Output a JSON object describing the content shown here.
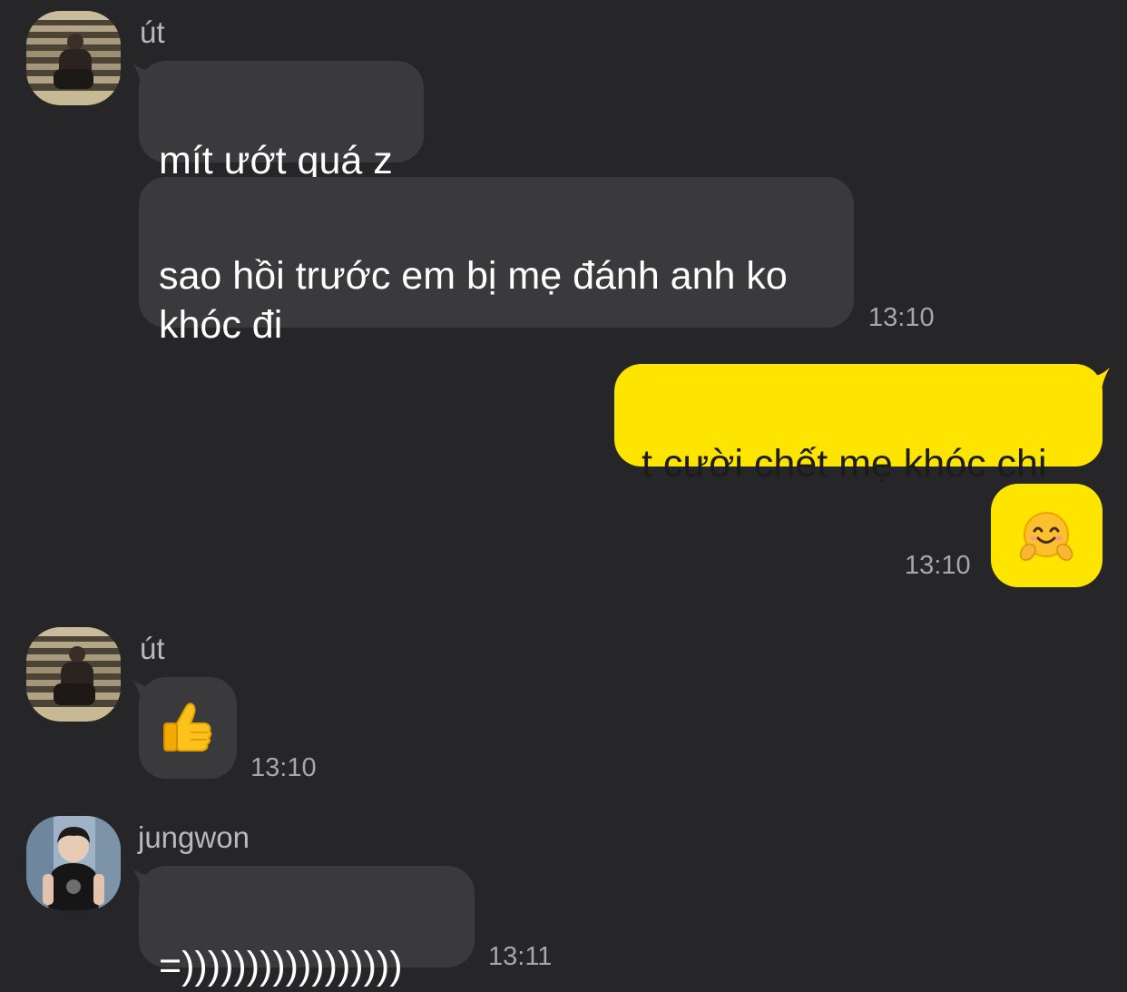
{
  "messages": [
    {
      "type": "received",
      "sender": "út",
      "text": "mít ướt quá z"
    },
    {
      "type": "received",
      "text": "sao hồi trước em bị mẹ đánh anh ko\nkhóc đi",
      "time": "13:10"
    },
    {
      "type": "sent",
      "text": "t cười chết mẹ khóc chi"
    },
    {
      "type": "sent",
      "emoji": "hugging-face-emoji",
      "time": "13:10"
    },
    {
      "type": "received",
      "sender": "út",
      "emoji": "thumbs-up-emoji",
      "time": "13:10"
    },
    {
      "type": "received",
      "sender": "jungwon",
      "text": "=)))))))))))))))))",
      "time": "13:11"
    }
  ],
  "colors": {
    "background": "#262628",
    "received_bubble": "#3a3a3d",
    "sent_bubble": "#fde500",
    "timestamp": "#a7a7ab",
    "sender_name": "#b9b9bd"
  }
}
